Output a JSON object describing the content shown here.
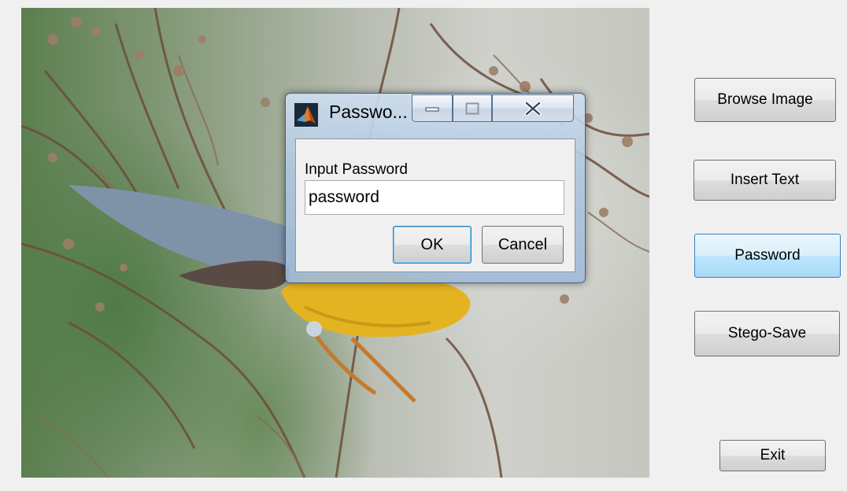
{
  "image_panel": {
    "description_icon": "bird-photo"
  },
  "buttons": {
    "browse": "Browse Image",
    "insert": "Insert Text",
    "password": "Password",
    "stego_save": "Stego-Save",
    "exit": "Exit"
  },
  "dialog": {
    "title": "Passwo...",
    "icon": "matlab-icon",
    "prompt": "Input Password",
    "input_value": "password",
    "ok_label": "OK",
    "cancel_label": "Cancel",
    "caption_icons": [
      "minimize-icon",
      "maximize-icon",
      "close-icon"
    ]
  },
  "colors": {
    "active_button": "#bee6fd",
    "dialog_frame": "#b0c8e0",
    "bird_yellow": "#e8b820"
  }
}
